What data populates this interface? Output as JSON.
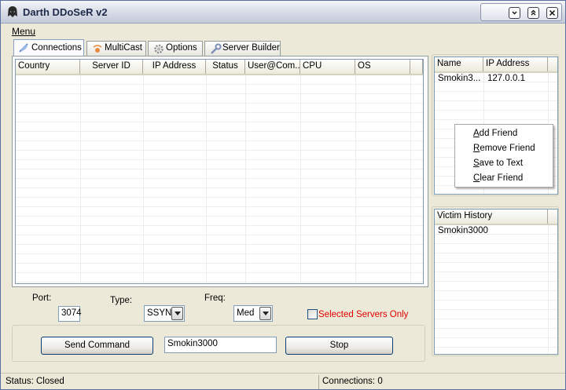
{
  "window": {
    "title": "Darth DDoSeR v2",
    "controls": {
      "minimize": "⊟",
      "maximize": "⊞",
      "close": "⊠"
    }
  },
  "menu": {
    "label": "Menu"
  },
  "tabs": [
    {
      "label": "Connections",
      "icon": "satellite-dish-icon",
      "active": true
    },
    {
      "label": "MultiCast",
      "icon": "broadcast-icon"
    },
    {
      "label": "Options",
      "icon": "gear-icon"
    },
    {
      "label": "Server Builder",
      "icon": "wrench-icon"
    }
  ],
  "connections": {
    "columns": [
      "Country",
      "Server ID",
      "IP Address",
      "Status",
      "User@Com...",
      "CPU",
      "OS"
    ],
    "rows": []
  },
  "friends": {
    "columns": [
      "Name",
      "IP Address"
    ],
    "rows": [
      {
        "name": "Smokin3...",
        "ip": "127.0.0.1"
      }
    ]
  },
  "context_menu": {
    "items": [
      {
        "accel": "A",
        "rest": "dd Friend"
      },
      {
        "accel": "R",
        "rest": "emove Friend"
      },
      {
        "accel": "S",
        "rest": "ave to Text"
      },
      {
        "accel": "C",
        "rest": "lear Friend"
      }
    ]
  },
  "victim_history": {
    "header": "Victim History",
    "rows": [
      "Smokin3000"
    ]
  },
  "controls": {
    "port_label": "Port:",
    "port_value": "3074",
    "type_label": "Type:",
    "type_value": "SSYN",
    "freq_label": "Freq:",
    "freq_value": "Med",
    "selected_only_label": "Selected Servers Only",
    "send_label": "Send Command",
    "target_value": "Smokin3000",
    "stop_label": "Stop"
  },
  "status": {
    "left": "Status: Closed",
    "connections": "Connections: 0"
  },
  "colors": {
    "accent_red": "#e00000",
    "title_text": "#1e2a4a",
    "list_border": "#7f9db9"
  }
}
